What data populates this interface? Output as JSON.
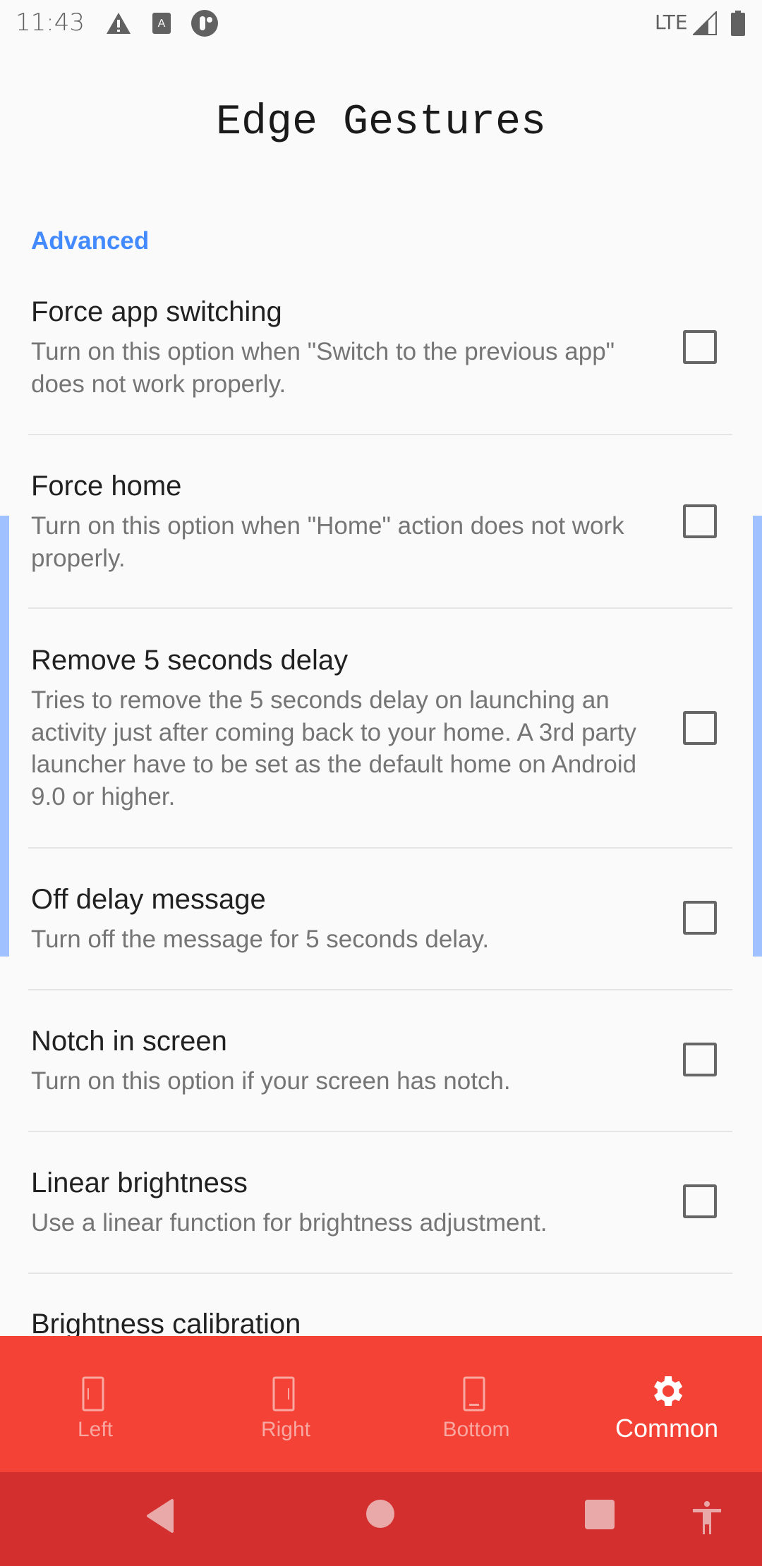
{
  "status_bar": {
    "time": "11:43",
    "network": "LTE",
    "icons": [
      "warning-icon",
      "a-notification-icon",
      "app-notification-icon",
      "signal-icon",
      "battery-icon"
    ]
  },
  "header": {
    "title": "Edge Gestures"
  },
  "section": {
    "label": "Advanced"
  },
  "items": [
    {
      "title": "Force app switching",
      "description": "Turn on this option when \"Switch to the previous app\" does not work properly.",
      "checked": false
    },
    {
      "title": "Force home",
      "description": "Turn on this option when \"Home\" action does not work properly.",
      "checked": false
    },
    {
      "title": "Remove 5 seconds delay",
      "description": "Tries to remove the 5 seconds delay on launching an activity just after coming back to your home. A 3rd party launcher have to be set as the default home on Android 9.0 or higher.",
      "checked": false
    },
    {
      "title": "Off delay message",
      "description": "Turn off the message for 5 seconds delay.",
      "checked": false
    },
    {
      "title": "Notch in screen",
      "description": "Turn on this option if your screen has notch.",
      "checked": false
    },
    {
      "title": "Linear brightness",
      "description": "Use a linear function for brightness adjustment.",
      "checked": false
    },
    {
      "title": "Brightness calibration"
    }
  ],
  "bottom_nav": {
    "tabs": [
      {
        "label": "Left"
      },
      {
        "label": "Right"
      },
      {
        "label": "Bottom"
      },
      {
        "label": "Common"
      }
    ],
    "active": "Common"
  },
  "colors": {
    "accent": "#448aff",
    "primary": "#f44336",
    "primary_dark": "#d32f2f",
    "edge_overlay": "#9fc1ff"
  }
}
